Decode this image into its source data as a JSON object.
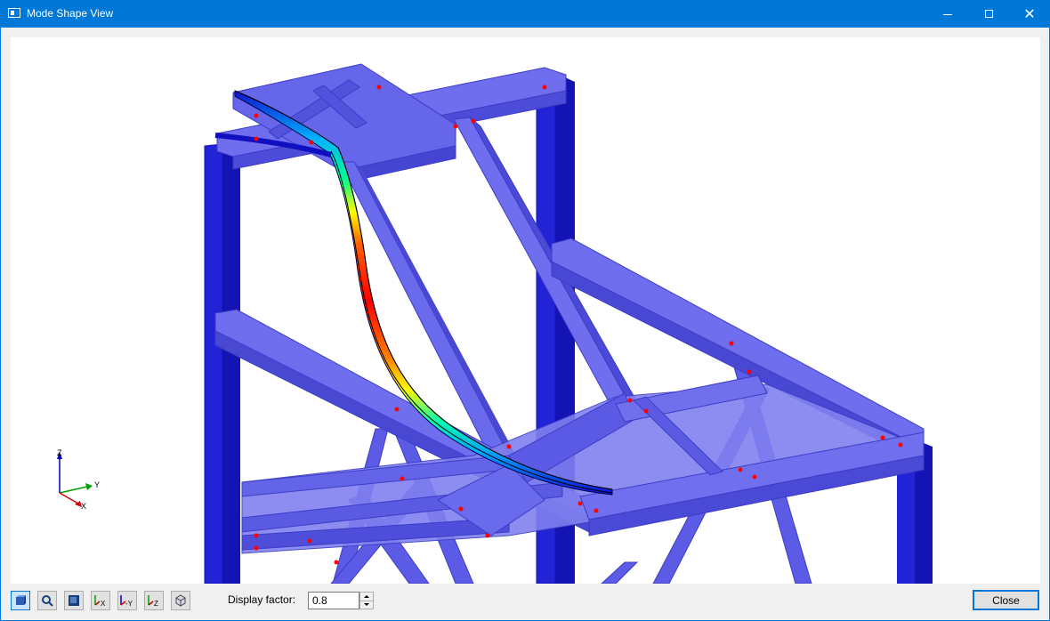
{
  "window": {
    "title": "Mode Shape View",
    "controls": {
      "minimize": "minimize",
      "maximize": "maximize",
      "close": "close"
    }
  },
  "view": {
    "axes": {
      "z": "Z",
      "y": "Y",
      "x": "X"
    },
    "colors": {
      "member": "#5b5be6",
      "column": "#2323d6",
      "column_dark": "#1414b4",
      "support_marks": "#ff0000",
      "deformed_gradient": [
        "#1010d0",
        "#00c8ff",
        "#00ff80",
        "#ffff00",
        "#ff8000",
        "#ff0000"
      ]
    }
  },
  "toolbar": {
    "buttons": [
      {
        "name": "view-toggle",
        "icon": "cube-select-icon"
      },
      {
        "name": "zoom",
        "icon": "magnifier-icon"
      },
      {
        "name": "render-mode",
        "icon": "render-mode-icon"
      },
      {
        "name": "view-x",
        "icon": "view-x-icon",
        "label": "X"
      },
      {
        "name": "view-minus-y",
        "icon": "view-minus-y-icon",
        "label": "-Y"
      },
      {
        "name": "view-z",
        "icon": "view-z-icon",
        "label": "Z"
      },
      {
        "name": "isometric",
        "icon": "iso-view-icon"
      }
    ],
    "display_factor_label": "Display factor:",
    "display_factor_value": "0.8",
    "close_label": "Close"
  }
}
